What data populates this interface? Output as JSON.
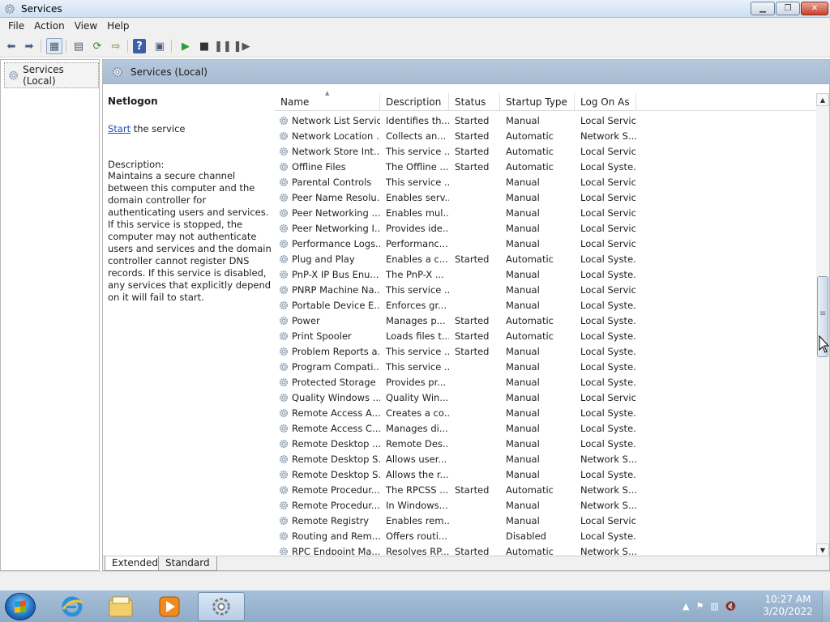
{
  "window": {
    "title": "Services"
  },
  "menu": [
    "File",
    "Action",
    "View",
    "Help"
  ],
  "toolbar": {
    "icons": [
      "back-icon",
      "forward-icon",
      "console-tree-icon",
      "properties-icon",
      "refresh-icon",
      "export-icon",
      "help-icon",
      "view-icon",
      "play-icon",
      "stop-icon",
      "pause-icon",
      "restart-icon"
    ]
  },
  "tree": {
    "root_label": "Services (Local)"
  },
  "header": {
    "title": "Services (Local)"
  },
  "detail": {
    "service_name": "Netlogon",
    "start_link": "Start",
    "start_rest": " the service",
    "description_label": "Description:",
    "description": "Maintains a secure channel between this computer and the domain controller for authenticating users and services. If this service is stopped, the computer may not authenticate users and services and the domain controller cannot register DNS records. If this service is disabled, any services that explicitly depend on it will fail to start."
  },
  "columns": [
    "Name",
    "Description",
    "Status",
    "Startup Type",
    "Log On As"
  ],
  "rows": [
    [
      "Network List Service",
      "Identifies th...",
      "Started",
      "Manual",
      "Local Service"
    ],
    [
      "Network Location ...",
      "Collects an...",
      "Started",
      "Automatic",
      "Network S..."
    ],
    [
      "Network Store Int...",
      "This service ...",
      "Started",
      "Automatic",
      "Local Service"
    ],
    [
      "Offline Files",
      "The Offline ...",
      "Started",
      "Automatic",
      "Local Syste..."
    ],
    [
      "Parental Controls",
      "This service ...",
      "",
      "Manual",
      "Local Service"
    ],
    [
      "Peer Name Resolu...",
      "Enables serv...",
      "",
      "Manual",
      "Local Service"
    ],
    [
      "Peer Networking ...",
      "Enables mul...",
      "",
      "Manual",
      "Local Service"
    ],
    [
      "Peer Networking I...",
      "Provides ide...",
      "",
      "Manual",
      "Local Service"
    ],
    [
      "Performance Logs...",
      "Performanc...",
      "",
      "Manual",
      "Local Service"
    ],
    [
      "Plug and Play",
      "Enables a c...",
      "Started",
      "Automatic",
      "Local Syste..."
    ],
    [
      "PnP-X IP Bus Enu...",
      "The PnP-X ...",
      "",
      "Manual",
      "Local Syste..."
    ],
    [
      "PNRP Machine Na...",
      "This service ...",
      "",
      "Manual",
      "Local Service"
    ],
    [
      "Portable Device E...",
      "Enforces gr...",
      "",
      "Manual",
      "Local Syste..."
    ],
    [
      "Power",
      "Manages p...",
      "Started",
      "Automatic",
      "Local Syste..."
    ],
    [
      "Print Spooler",
      "Loads files t...",
      "Started",
      "Automatic",
      "Local Syste..."
    ],
    [
      "Problem Reports a...",
      "This service ...",
      "Started",
      "Manual",
      "Local Syste..."
    ],
    [
      "Program Compati...",
      "This service ...",
      "",
      "Manual",
      "Local Syste..."
    ],
    [
      "Protected Storage",
      "Provides pr...",
      "",
      "Manual",
      "Local Syste..."
    ],
    [
      "Quality Windows ...",
      "Quality Win...",
      "",
      "Manual",
      "Local Service"
    ],
    [
      "Remote Access A...",
      "Creates a co...",
      "",
      "Manual",
      "Local Syste..."
    ],
    [
      "Remote Access C...",
      "Manages di...",
      "",
      "Manual",
      "Local Syste..."
    ],
    [
      "Remote Desktop ...",
      "Remote Des...",
      "",
      "Manual",
      "Local Syste..."
    ],
    [
      "Remote Desktop S...",
      "Allows user...",
      "",
      "Manual",
      "Network S..."
    ],
    [
      "Remote Desktop S...",
      "Allows the r...",
      "",
      "Manual",
      "Local Syste..."
    ],
    [
      "Remote Procedur...",
      "The RPCSS ...",
      "Started",
      "Automatic",
      "Network S..."
    ],
    [
      "Remote Procedur...",
      "In Windows...",
      "",
      "Manual",
      "Network S..."
    ],
    [
      "Remote Registry",
      "Enables rem...",
      "",
      "Manual",
      "Local Service"
    ],
    [
      "Routing and Rem...",
      "Offers routi...",
      "",
      "Disabled",
      "Local Syste..."
    ],
    [
      "RPC Endpoint Ma...",
      "Resolves RP...",
      "Started",
      "Automatic",
      "Network S..."
    ]
  ],
  "tabs": [
    "Extended",
    "Standard"
  ],
  "taskbar": {
    "apps": [
      "internet-explorer-icon",
      "windows-explorer-icon",
      "media-player-icon",
      "services-icon"
    ],
    "time": "10:27 AM",
    "date": "3/20/2022"
  }
}
